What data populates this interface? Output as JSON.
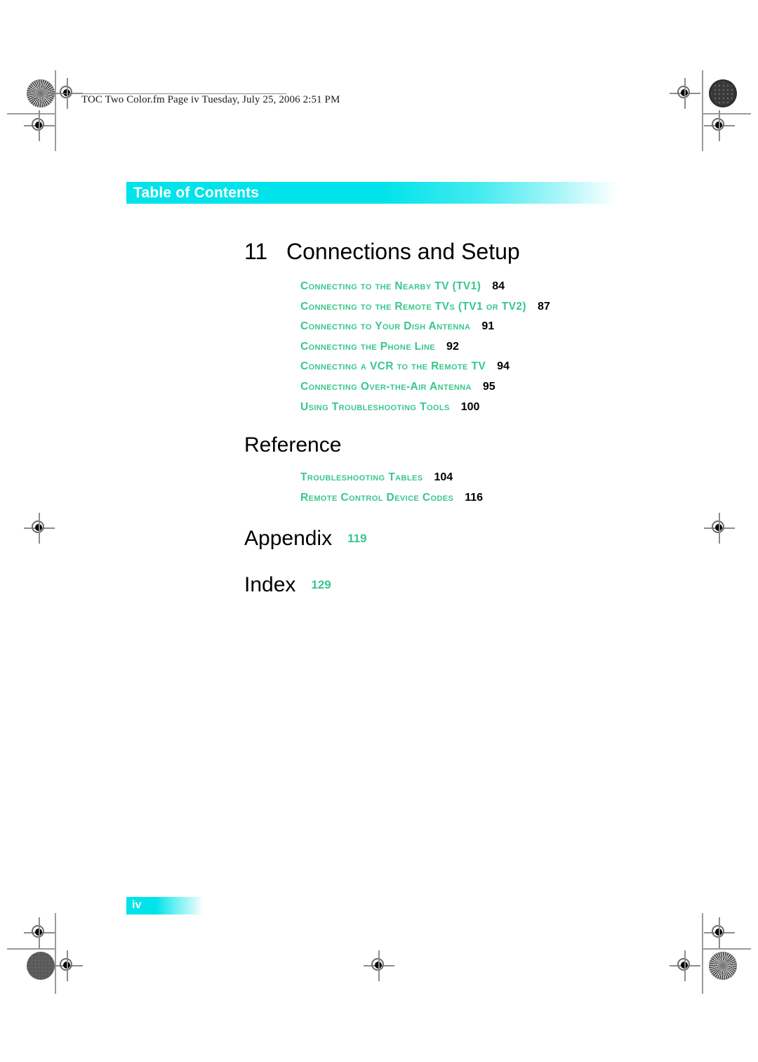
{
  "header": {
    "running_text": "TOC Two Color.fm  Page iv  Tuesday, July 25, 2006  2:51 PM"
  },
  "banner": {
    "label": "Table of Contents",
    "color": "#00e3ea"
  },
  "chapter": {
    "number": "11",
    "title": "Connections and Setup",
    "entries": [
      {
        "title": "Connecting to the Nearby TV (TV1)",
        "page": "84"
      },
      {
        "title": "Connecting to the Remote TVs (TV1 or TV2)",
        "page": "87"
      },
      {
        "title": "Connecting to Your Dish Antenna",
        "page": "91"
      },
      {
        "title": "Connecting the Phone Line",
        "page": "92"
      },
      {
        "title": "Connecting a VCR to the Remote TV",
        "page": "94"
      },
      {
        "title": "Connecting Over-the-Air Antenna",
        "page": "95"
      },
      {
        "title": "Using Troubleshooting Tools",
        "page": "100"
      }
    ]
  },
  "reference": {
    "title": "Reference",
    "entries": [
      {
        "title": "Troubleshooting Tables",
        "page": "104"
      },
      {
        "title": "Remote Control Device Codes",
        "page": "116"
      }
    ]
  },
  "appendix": {
    "title": "Appendix",
    "page": "119"
  },
  "index": {
    "title": "Index",
    "page": "129"
  },
  "footer": {
    "folio": "iv"
  },
  "colors": {
    "entry_teal": "#39c78d",
    "banner_cyan": "#00e3ea",
    "text_black": "#000000"
  }
}
